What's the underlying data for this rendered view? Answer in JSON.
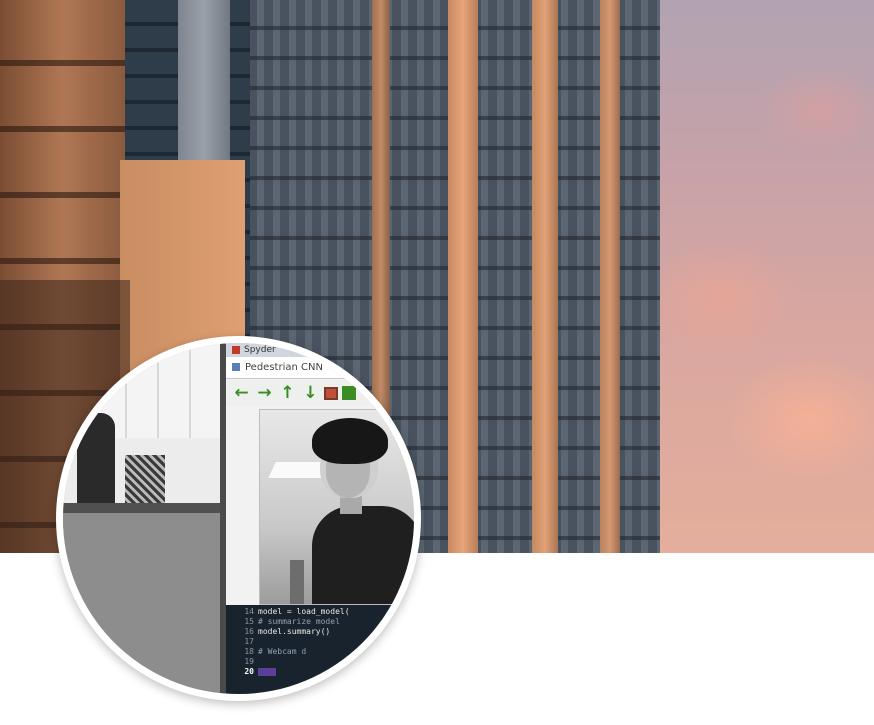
{
  "screenshot": {
    "window": {
      "app_title": "Spyder",
      "figure_title": "Pedestrian CNN",
      "toolbar_icons": [
        "arrow-left-icon",
        "arrow-right-icon",
        "arrow-up-icon",
        "arrow-down-icon",
        "save-icon",
        "more-icon"
      ]
    },
    "editor": {
      "lines": [
        {
          "num": "14",
          "text": "model = load_model(",
          "style": "code"
        },
        {
          "num": "15",
          "text": "# summarize model",
          "style": "comment"
        },
        {
          "num": "16",
          "text": "model.summary()",
          "style": "code"
        },
        {
          "num": "17",
          "text": "",
          "style": "code"
        },
        {
          "num": "18",
          "text": "# Webcam d",
          "style": "comment"
        },
        {
          "num": "19",
          "text": "",
          "style": "code"
        },
        {
          "num": "20",
          "text": "",
          "style": "active"
        }
      ]
    }
  },
  "colors": {
    "toolbar_icon": "#3b8c23",
    "editor_bg": "#19232d",
    "avatar_border": "#ffffff"
  }
}
